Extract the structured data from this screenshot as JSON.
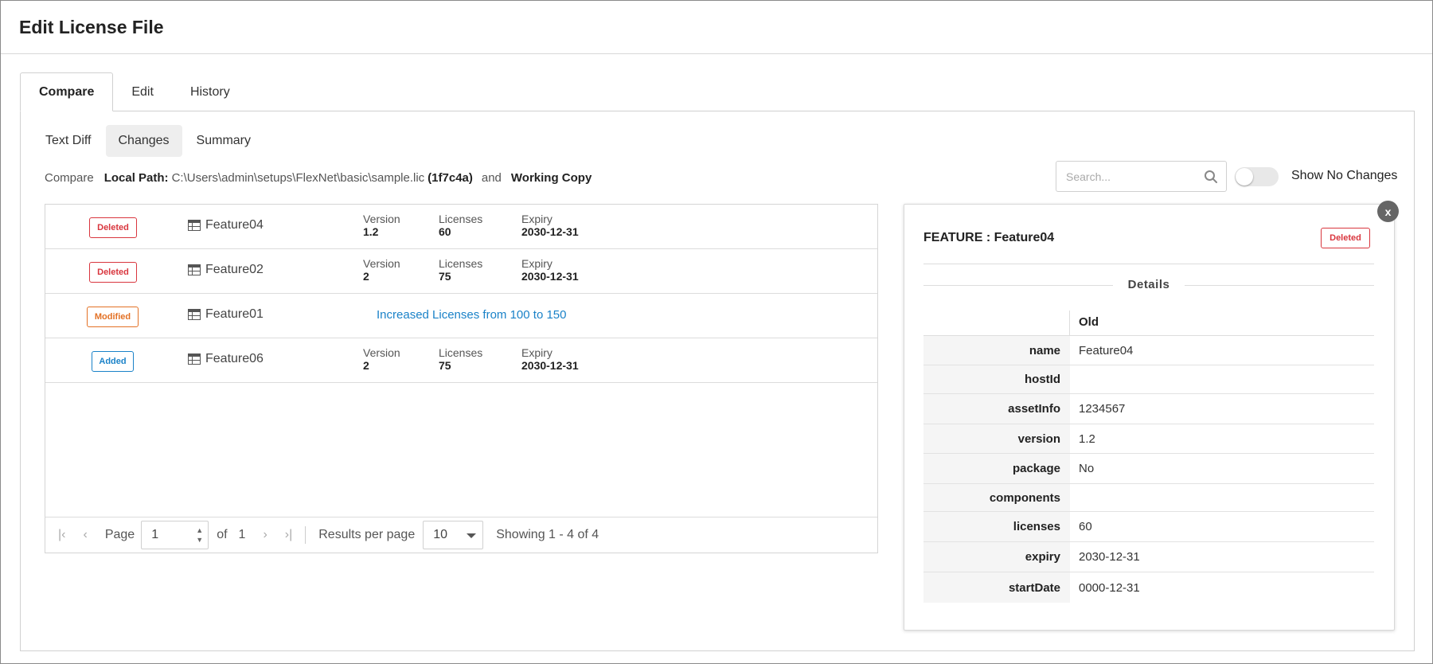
{
  "window": {
    "title": "Edit License File"
  },
  "tabs": [
    {
      "label": "Compare",
      "active": true
    },
    {
      "label": "Edit",
      "active": false
    },
    {
      "label": "History",
      "active": false
    }
  ],
  "subtabs": [
    {
      "label": "Text Diff",
      "active": false
    },
    {
      "label": "Changes",
      "active": true
    },
    {
      "label": "Summary",
      "active": false
    }
  ],
  "compare": {
    "prefix": "Compare",
    "local_path_label": "Local Path:",
    "path": "C:\\Users\\admin\\setups\\FlexNet\\basic\\sample.lic",
    "hash": "(1f7c4a)",
    "and": "and",
    "target": "Working Copy"
  },
  "search": {
    "placeholder": "Search...",
    "value": ""
  },
  "toggle": {
    "label": "Show No Changes",
    "on": false
  },
  "columns": {
    "version": "Version",
    "licenses": "Licenses",
    "expiry": "Expiry"
  },
  "rows": [
    {
      "status": "Deleted",
      "name": "Feature04",
      "version": "1.2",
      "licenses": "60",
      "expiry": "2030-12-31"
    },
    {
      "status": "Deleted",
      "name": "Feature02",
      "version": "2",
      "licenses": "75",
      "expiry": "2030-12-31"
    },
    {
      "status": "Modified",
      "name": "Feature01",
      "change": "Increased Licenses from 100 to 150"
    },
    {
      "status": "Added",
      "name": "Feature06",
      "version": "2",
      "licenses": "75",
      "expiry": "2030-12-31"
    }
  ],
  "pager": {
    "page_label": "Page",
    "page": "1",
    "of_label": "of",
    "total_pages": "1",
    "rpp_label": "Results per page",
    "rpp": "10",
    "showing": "Showing 1 - 4 of 4"
  },
  "detail": {
    "close_label": "x",
    "title": "FEATURE : Feature04",
    "status": "Deleted",
    "section": "Details",
    "col_old": "Old",
    "fields": [
      {
        "key": "name",
        "value": "Feature04"
      },
      {
        "key": "hostId",
        "value": ""
      },
      {
        "key": "assetInfo",
        "value": "1234567"
      },
      {
        "key": "version",
        "value": "1.2"
      },
      {
        "key": "package",
        "value": "No"
      },
      {
        "key": "components",
        "value": ""
      },
      {
        "key": "licenses",
        "value": "60"
      },
      {
        "key": "expiry",
        "value": "2030-12-31"
      },
      {
        "key": "startDate",
        "value": "0000-12-31"
      }
    ]
  },
  "colors": {
    "deleted": "#d9363e",
    "modified": "#e37125",
    "added": "#1a82c8",
    "link": "#1a82c8"
  }
}
